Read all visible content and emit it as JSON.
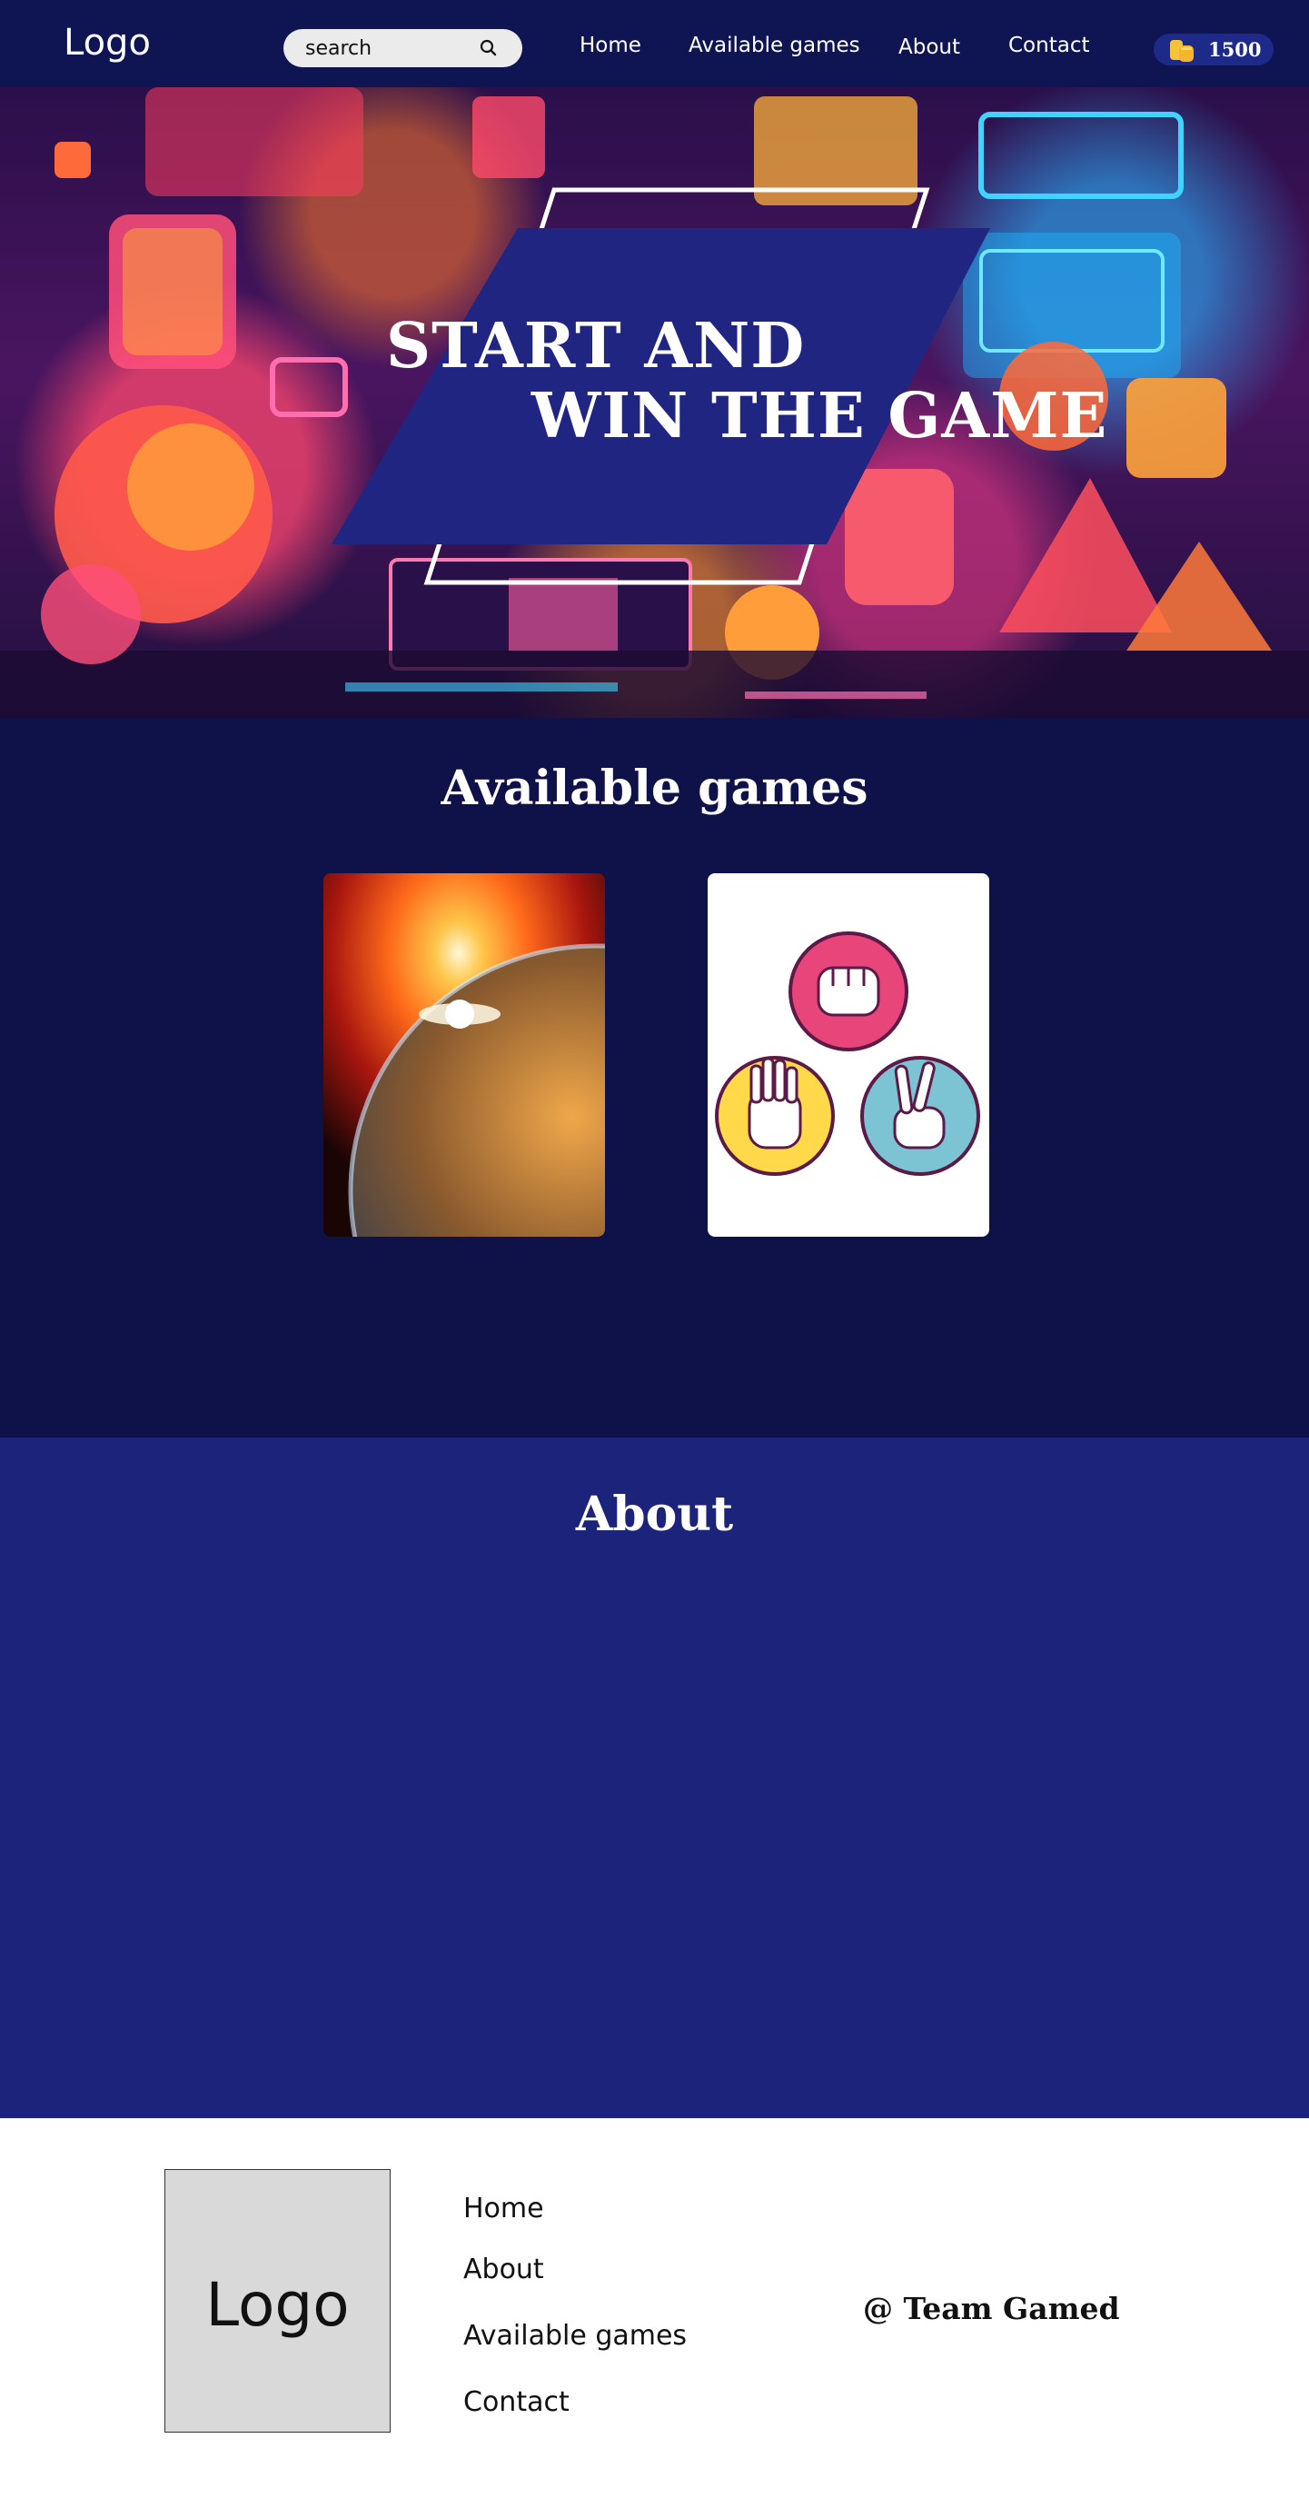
{
  "nav": {
    "logo": "Logo",
    "search_placeholder": "search",
    "links": [
      "Home",
      "Available games",
      "About",
      "Contact"
    ],
    "coins": "1500",
    "colors": {
      "background": "#0e1552",
      "coin_badge": "#1e2a8a",
      "coin_icon": "#f6c33a"
    }
  },
  "hero": {
    "line1": "START AND",
    "line2": "WIN THE GAME",
    "colors": {
      "banner": "#1f2580",
      "outline": "#ffffff"
    }
  },
  "games": {
    "title": "Available games",
    "cards": [
      {
        "name": "earth-sunrise-game",
        "alt": "Earth with sunrise"
      },
      {
        "name": "rock-paper-scissors-game",
        "alt": "Rock paper scissors"
      }
    ],
    "colors": {
      "background": "#0e1248"
    }
  },
  "about": {
    "title": "About",
    "colors": {
      "background": "#1c237a"
    }
  },
  "footer": {
    "logo": "Logo",
    "links": [
      "Home",
      "About",
      "Available games",
      "Contact"
    ],
    "credit": "@ Team Gamed"
  }
}
